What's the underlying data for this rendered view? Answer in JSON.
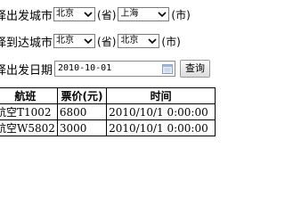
{
  "form": {
    "departure": {
      "label": "择出发城市",
      "province_value": "北京",
      "city_value": "上海",
      "province_suffix": "(省)",
      "city_suffix": "(市)"
    },
    "arrival": {
      "label": "择到达城市",
      "province_value": "北京",
      "city_value": "北京",
      "province_suffix": "(省)",
      "city_suffix": "(市)"
    },
    "date": {
      "label": "择出发日期",
      "value": "2010-10-01"
    },
    "query_button": "查询"
  },
  "table": {
    "headers": [
      "航班",
      "票价(元)",
      "时间"
    ],
    "rows": [
      [
        "航空T1002",
        "6800",
        "2010/10/1 0:00:00"
      ],
      [
        "航空W5802",
        "3000",
        "2010/10/1 0:00:00"
      ]
    ]
  },
  "icons": {
    "dropdown": "chevron-down-icon",
    "calendar": "calendar-icon"
  }
}
